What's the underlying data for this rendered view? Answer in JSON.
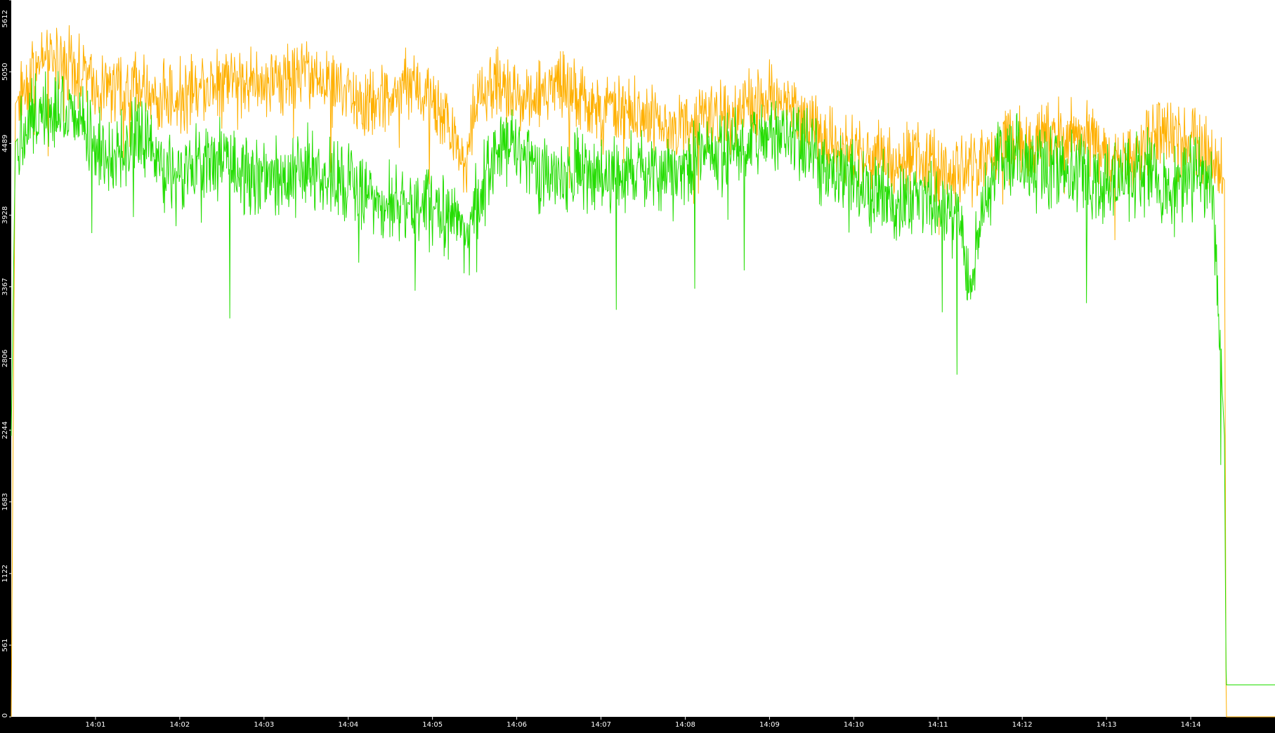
{
  "chart_data": {
    "type": "line",
    "background_color": "#000000",
    "plot_background_color": "#ffffff",
    "axis_text_color": "#ffffff",
    "grid": false,
    "legend": "none",
    "ylim": [
      0,
      5612
    ],
    "yticks": [
      0,
      561,
      1122,
      1683,
      2244,
      2806,
      3367,
      3928,
      4489,
      5050,
      5612
    ],
    "xticks": [
      "14:01",
      "14:02",
      "14:03",
      "14:04",
      "14:05",
      "14:06",
      "14:07",
      "14:08",
      "14:09",
      "14:10",
      "14:11",
      "14:12",
      "14:13",
      "14:14"
    ],
    "x_minutes": {
      "start": 0.0,
      "end": 15.0,
      "tick_start": 1,
      "tick_step": 1
    },
    "series": [
      {
        "color": "#ffb000",
        "time_minutes": [
          0.0,
          0.05,
          0.25,
          0.5,
          0.75,
          1.0,
          1.25,
          1.5,
          1.75,
          2.0,
          2.25,
          2.5,
          2.75,
          3.0,
          3.25,
          3.5,
          3.75,
          4.0,
          4.25,
          4.5,
          4.75,
          5.0,
          5.25,
          5.4,
          5.5,
          5.75,
          6.0,
          6.25,
          6.5,
          6.75,
          7.0,
          7.25,
          7.5,
          7.75,
          8.0,
          8.25,
          8.5,
          8.75,
          9.0,
          9.25,
          9.5,
          9.75,
          10.0,
          10.25,
          10.5,
          10.75,
          11.0,
          11.25,
          11.5,
          11.75,
          12.0,
          12.25,
          12.5,
          12.75,
          13.0,
          13.25,
          13.5,
          13.75,
          14.0,
          14.25,
          14.4,
          14.42,
          14.5,
          15.0
        ],
        "values": [
          0,
          4800,
          5050,
          5150,
          5100,
          4950,
          4900,
          4950,
          4850,
          4850,
          4950,
          5000,
          5000,
          4950,
          5000,
          5050,
          4950,
          4850,
          4800,
          4850,
          4950,
          4850,
          4550,
          4300,
          4800,
          4950,
          4900,
          4850,
          4950,
          4850,
          4700,
          4750,
          4700,
          4600,
          4650,
          4650,
          4700,
          4800,
          4850,
          4750,
          4600,
          4450,
          4450,
          4400,
          4350,
          4400,
          4300,
          4250,
          4350,
          4450,
          4500,
          4550,
          4600,
          4550,
          4400,
          4350,
          4500,
          4550,
          4500,
          4400,
          4200,
          0,
          0,
          0
        ],
        "jitter": 260
      },
      {
        "color": "#22dd00",
        "time_minutes": [
          0.0,
          0.05,
          0.25,
          0.5,
          0.75,
          1.0,
          1.25,
          1.5,
          1.75,
          2.0,
          2.25,
          2.5,
          2.75,
          3.0,
          3.25,
          3.5,
          3.75,
          4.0,
          4.25,
          4.5,
          4.75,
          5.0,
          5.25,
          5.4,
          5.5,
          5.75,
          6.0,
          6.25,
          6.5,
          6.75,
          7.0,
          7.25,
          7.5,
          7.75,
          8.0,
          8.25,
          8.5,
          8.75,
          9.0,
          9.25,
          9.5,
          9.75,
          10.0,
          10.25,
          10.5,
          10.75,
          11.0,
          11.25,
          11.4,
          11.5,
          11.75,
          12.0,
          12.25,
          12.5,
          12.75,
          13.0,
          13.25,
          13.5,
          13.75,
          14.0,
          14.25,
          14.4,
          14.42,
          15.0
        ],
        "values": [
          2200,
          4500,
          4700,
          4800,
          4750,
          4500,
          4400,
          4550,
          4300,
          4200,
          4350,
          4400,
          4300,
          4200,
          4250,
          4300,
          4250,
          4150,
          4100,
          4050,
          4000,
          3950,
          3900,
          3700,
          4000,
          4400,
          4500,
          4300,
          4200,
          4300,
          4200,
          4250,
          4300,
          4200,
          4300,
          4400,
          4450,
          4450,
          4600,
          4500,
          4400,
          4250,
          4200,
          4100,
          4050,
          4050,
          4000,
          3950,
          3300,
          4000,
          4350,
          4400,
          4250,
          4300,
          4250,
          4150,
          4200,
          4300,
          4100,
          4200,
          4300,
          2200,
          250,
          250
        ],
        "jitter": 300
      }
    ]
  }
}
